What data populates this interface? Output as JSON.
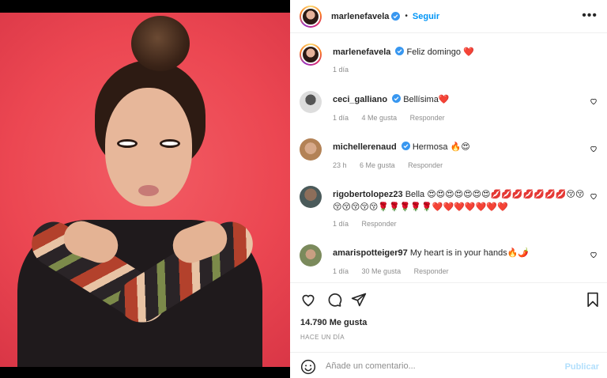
{
  "header": {
    "username": "marlenefavela",
    "separator": "•",
    "follow_label": "Seguir",
    "more_label": "•••"
  },
  "caption": {
    "username": "marlenefavela",
    "text": "Feliz domingo ❤️",
    "time": "1 día"
  },
  "comments": [
    {
      "username": "ceci_galliano",
      "text": "Bellísima❤️",
      "time": "1 día",
      "likes": "4 Me gusta",
      "reply": "Responder"
    },
    {
      "username": "michellerenaud",
      "text": "Hermosa 🔥😍",
      "time": "23 h",
      "likes": "6 Me gusta",
      "reply": "Responder"
    },
    {
      "username": "rigobertolopez23",
      "text": "Bella 😍😍😍😍😍😍😍💋💋💋💋💋💋💋😚😚😚😚😚😚😚🌹🌹🌹🌹🌹❤️❤️❤️❤️❤️❤️❤️",
      "time": "1 día",
      "reply": "Responder"
    },
    {
      "username": "amarispotteiger97",
      "text": "My heart is in your hands🔥🌶️",
      "time": "1 día",
      "likes": "30 Me gusta",
      "reply": "Responder"
    }
  ],
  "actions": {
    "like_count": "14.790 Me gusta",
    "timestamp": "HACE UN DÍA"
  },
  "composer": {
    "placeholder": "Añade un comentario...",
    "publish_label": "Publicar"
  },
  "colors": {
    "link_blue": "#0095f6",
    "publish_disabled": "#b2dffc",
    "verified_blue": "#3897f0",
    "photo_background": "#ec4752"
  },
  "icons": [
    "verified-badge-icon",
    "heart-icon",
    "comment-icon",
    "share-icon",
    "bookmark-icon",
    "emoji-icon",
    "more-options-icon"
  ]
}
